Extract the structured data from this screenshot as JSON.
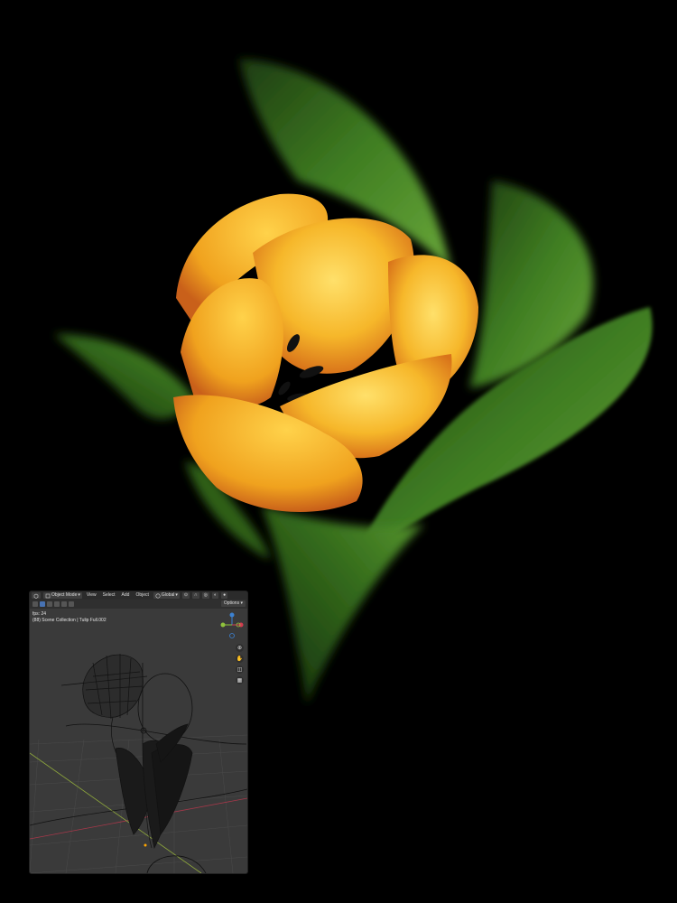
{
  "viewport": {
    "header": {
      "mode_label": "Object Mode",
      "menu": [
        "View",
        "Select",
        "Add",
        "Object"
      ],
      "transform_orientation": "Global",
      "options_label": "Options"
    },
    "overlay": {
      "fps_label": "fps: 24",
      "collection_label": "(88) Scene Collection | Tulip Full.002"
    }
  },
  "colors": {
    "petal": "#f2b41e",
    "leaf": "#3f7d22",
    "viewport_bg": "#3a3a3a",
    "axis_x": "#d23c50",
    "axis_y": "#8fc23c",
    "axis_z": "#3c82d2"
  }
}
